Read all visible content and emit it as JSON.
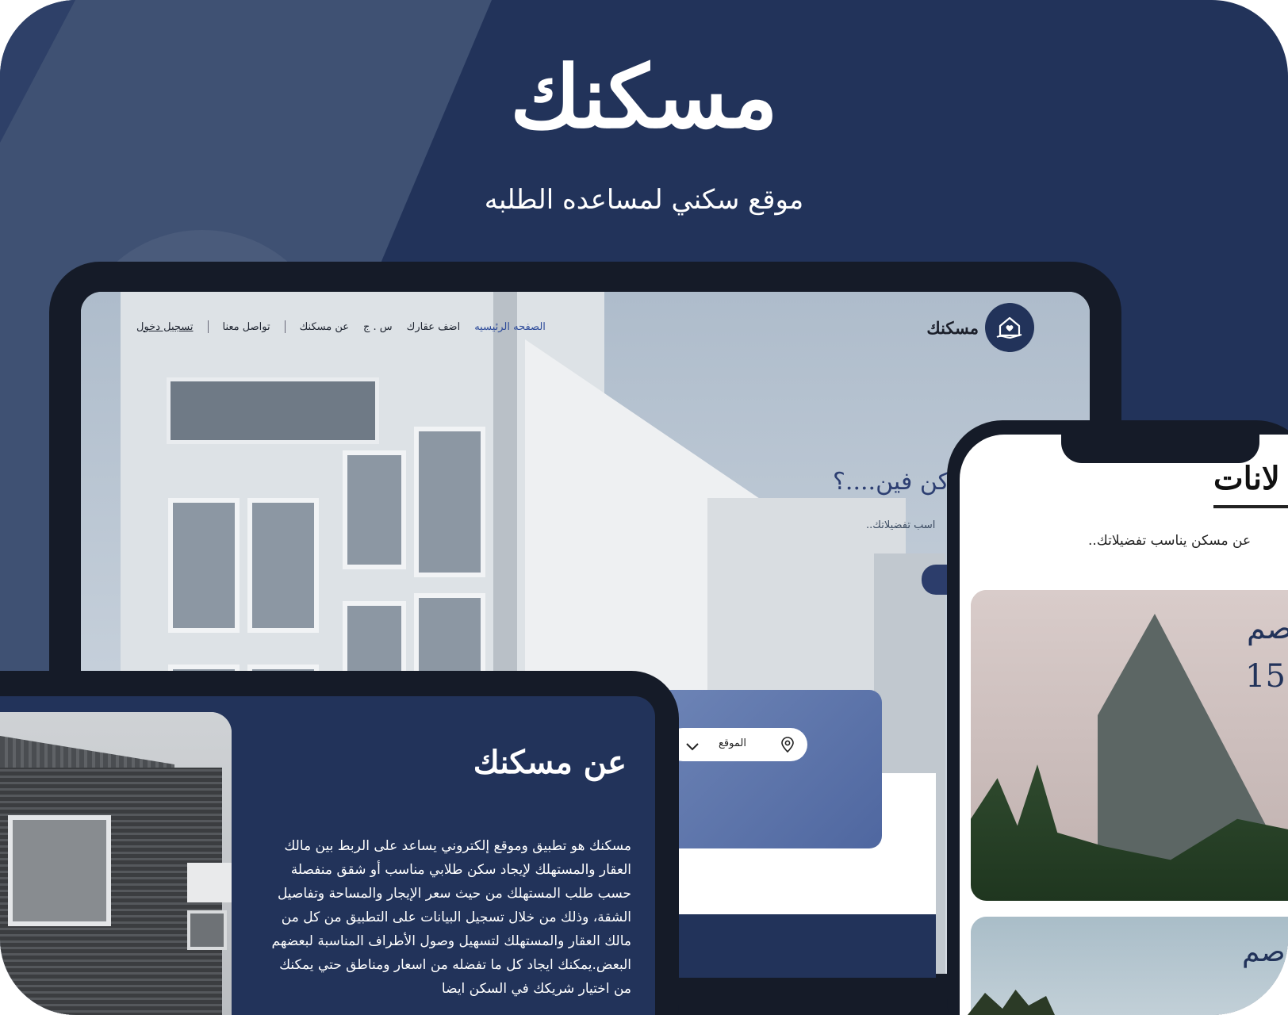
{
  "hero": {
    "title": "مسكنك",
    "subtitle": "موقع سكني لمساعده الطلبه"
  },
  "tablet": {
    "brand": "مسكنك",
    "nav": {
      "home": "الصفحه الرئيسيه",
      "add_property": "اضف عقارك",
      "contact_partial": "س . ج",
      "about": "عن مسكنك",
      "contact": "تواصل معنا",
      "login": "تسجيل دخول"
    },
    "hero_question": "كن فين....؟",
    "hero_subtext": "اسب تفضيلاتك..",
    "search": {
      "location_label": "الموقع"
    }
  },
  "about": {
    "title": "عن مسكنك",
    "paragraph": "مسكنك هو تطبيق وموقع إلكتروني يساعد على الربط بين مالك العقار والمستهلك لإيجاد سكن طلابي مناسب أو شقق منفصلة حسب طلب المستهلك من حيث سعر الإيجار والمساحة وتفاصيل الشقة، وذلك من خلال تسجيل البيانات على التطبيق من كل من مالك العقار والمستهلك لتسهيل وصول الأطراف المناسبة لبعضهم البعض.يمكنك ايجاد كل ما تفضله من اسعار ومناطق حتي يمكنك من اختيار شريكك في السكن ايضا"
  },
  "phone": {
    "section_title": "لانات",
    "section_subtitle": "عن مسكن يناسب تفضيلاتك..",
    "card1": {
      "location_partial": "صم",
      "price_partial": "15"
    },
    "card2": {
      "location_partial": "صم"
    }
  },
  "colors": {
    "navy": "#22335a",
    "accent_blue": "#2d4b9a",
    "device_frame": "#151b28"
  }
}
